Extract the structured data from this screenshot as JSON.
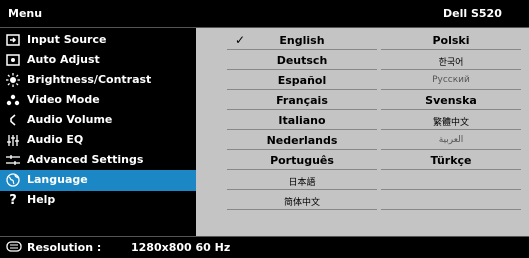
{
  "title": {
    "menu": "Menu",
    "brand": "Dell S520"
  },
  "sidebar": {
    "items": [
      {
        "label": "Input Source",
        "icon": "input-source-icon"
      },
      {
        "label": "Auto Adjust",
        "icon": "auto-adjust-icon"
      },
      {
        "label": "Brightness/Contrast",
        "icon": "brightness-icon"
      },
      {
        "label": "Video Mode",
        "icon": "video-mode-icon"
      },
      {
        "label": "Audio Volume",
        "icon": "speaker-icon"
      },
      {
        "label": "Audio EQ",
        "icon": "equalizer-icon"
      },
      {
        "label": "Advanced Settings",
        "icon": "sliders-icon"
      },
      {
        "label": "Language",
        "icon": "globe-icon",
        "active": true
      },
      {
        "label": "Help",
        "icon": "help-icon"
      }
    ]
  },
  "languages": {
    "left": [
      "English",
      "Deutsch",
      "Español",
      "Français",
      "Italiano",
      "Nederlands",
      "Português",
      "日本語",
      "简体中文"
    ],
    "right": [
      "Polski",
      "한국어",
      "Русский",
      "Svenska",
      "繁體中文",
      "العربية",
      "Türkçe",
      "",
      ""
    ],
    "selected": "English"
  },
  "status": {
    "label": "Resolution :",
    "value": "1280x800 60 Hz"
  },
  "colors": {
    "accent": "#1b87c4",
    "panel": "#c4c4c4"
  }
}
